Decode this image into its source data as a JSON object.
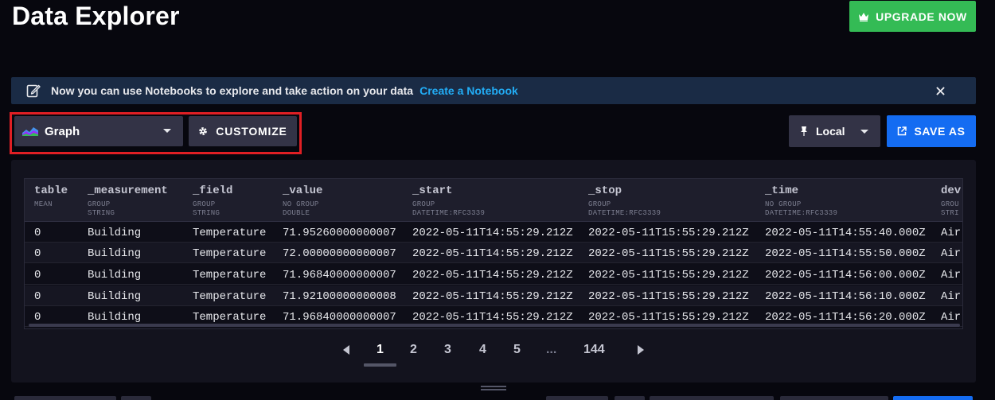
{
  "header": {
    "title": "Data Explorer",
    "upgrade_label": "UPGRADE NOW"
  },
  "banner": {
    "message": "Now you can use Notebooks to explore and take action on your data",
    "link_text": "Create a Notebook"
  },
  "toolbar": {
    "visualization_type": "Graph",
    "customize_label": "CUSTOMIZE",
    "timezone": "Local",
    "save_as_label": "SAVE AS"
  },
  "table": {
    "columns": [
      {
        "name": "table",
        "group": "MEAN",
        "type": ""
      },
      {
        "name": "_measurement",
        "group": "GROUP",
        "type": "STRING"
      },
      {
        "name": "_field",
        "group": "GROUP",
        "type": "STRING"
      },
      {
        "name": "_value",
        "group": "NO GROUP",
        "type": "DOUBLE"
      },
      {
        "name": "_start",
        "group": "GROUP",
        "type": "DATETIME:RFC3339"
      },
      {
        "name": "_stop",
        "group": "GROUP",
        "type": "DATETIME:RFC3339"
      },
      {
        "name": "_time",
        "group": "NO GROUP",
        "type": "DATETIME:RFC3339"
      },
      {
        "name": "dev",
        "group": "GROU",
        "type": "STRI"
      }
    ],
    "rows": [
      [
        "0",
        "Building",
        "Temperature",
        "71.95260000000007",
        "2022-05-11T14:55:29.212Z",
        "2022-05-11T15:55:29.212Z",
        "2022-05-11T14:55:40.000Z",
        "Air("
      ],
      [
        "0",
        "Building",
        "Temperature",
        "72.00000000000007",
        "2022-05-11T14:55:29.212Z",
        "2022-05-11T15:55:29.212Z",
        "2022-05-11T14:55:50.000Z",
        "Air("
      ],
      [
        "0",
        "Building",
        "Temperature",
        "71.96840000000007",
        "2022-05-11T14:55:29.212Z",
        "2022-05-11T15:55:29.212Z",
        "2022-05-11T14:56:00.000Z",
        "Air("
      ],
      [
        "0",
        "Building",
        "Temperature",
        "71.92100000000008",
        "2022-05-11T14:55:29.212Z",
        "2022-05-11T15:55:29.212Z",
        "2022-05-11T14:56:10.000Z",
        "Air("
      ],
      [
        "0",
        "Building",
        "Temperature",
        "71.96840000000007",
        "2022-05-11T14:55:29.212Z",
        "2022-05-11T15:55:29.212Z",
        "2022-05-11T14:56:20.000Z",
        "Air("
      ]
    ]
  },
  "pagination": {
    "pages": [
      "1",
      "2",
      "3",
      "4",
      "5",
      "...",
      "144"
    ],
    "current": "1"
  },
  "colors": {
    "upgrade": "#34bb55",
    "primary": "#146cf2",
    "link": "#22adf6",
    "highlight": "#e01f24"
  }
}
